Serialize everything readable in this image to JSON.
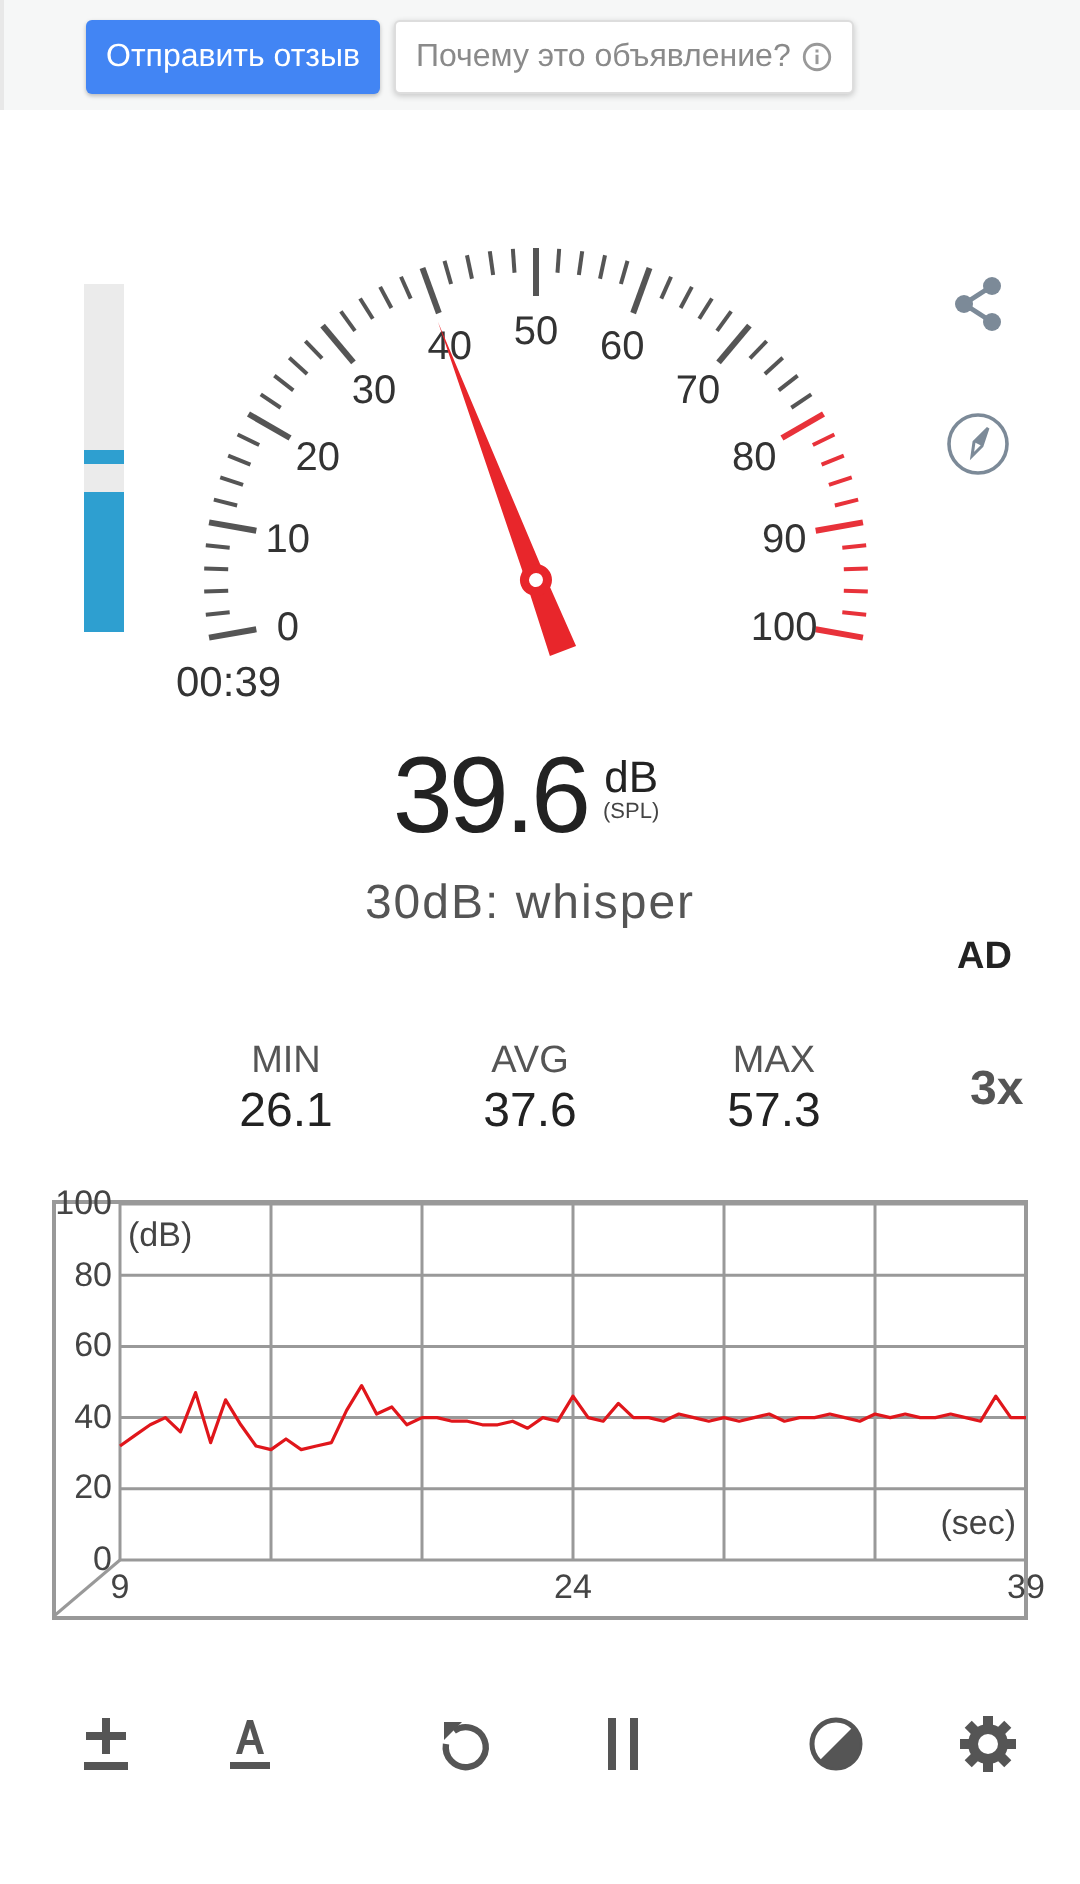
{
  "ad_bar": {
    "buttons": [
      {
        "label": "Отправить отзыв",
        "kind": "primary"
      },
      {
        "label": "Почему это объявление?",
        "kind": "info"
      }
    ]
  },
  "level_meter": {
    "level": 0.4,
    "peak": {
      "level": 0.48
    }
  },
  "gauge": {
    "scale": [
      {
        "label": "50",
        "danger": false
      },
      {
        "label": "40",
        "danger": false
      },
      {
        "label": "60",
        "danger": false
      },
      {
        "label": "30",
        "danger": false
      },
      {
        "label": "70",
        "danger": false
      },
      {
        "label": "20",
        "danger": false
      },
      {
        "label": "80",
        "danger": true
      },
      {
        "label": "10",
        "danger": false
      },
      {
        "label": "90",
        "danger": true
      },
      {
        "label": "0",
        "danger": false
      },
      {
        "label": "100",
        "danger": true
      }
    ]
  },
  "side_actions": [
    {
      "kind": "share"
    },
    {
      "kind": "compass"
    }
  ],
  "elapsed_time": "00:39",
  "reading": {
    "value": "39.6",
    "unit": "dB",
    "qualifier": "(SPL)"
  },
  "reference": "30dB: whisper",
  "ad_label": "AD",
  "stats": [
    {
      "label": "MIN",
      "value": "26.1"
    },
    {
      "label": "AVG",
      "value": "37.6"
    },
    {
      "label": "MAX",
      "value": "57.3"
    }
  ],
  "zoom": "3x",
  "chart": {
    "chart_data": {
      "type": "line",
      "grid": true,
      "xlabel": "(sec)",
      "ylabel": "(dB)",
      "xlim": [
        9,
        39
      ],
      "ylim": [
        0,
        100
      ],
      "xticks": [
        9,
        24,
        39
      ],
      "yticks": [
        0,
        20,
        40,
        60,
        80,
        100
      ],
      "x": [
        9,
        9.5,
        10,
        10.5,
        11,
        11.5,
        12,
        12.5,
        13,
        13.5,
        14,
        14.5,
        15,
        15.5,
        16,
        16.5,
        17,
        17.5,
        18,
        18.5,
        19,
        19.5,
        20,
        20.5,
        21,
        21.5,
        22,
        22.5,
        23,
        23.5,
        24,
        24.5,
        25,
        25.5,
        26,
        26.5,
        27,
        27.5,
        28,
        28.5,
        29,
        29.5,
        30,
        30.5,
        31,
        31.5,
        32,
        32.5,
        33,
        33.5,
        34,
        34.5,
        35,
        35.5,
        36,
        36.5,
        37,
        37.5,
        38,
        38.5,
        39
      ],
      "series": [
        {
          "color": "#e0161b",
          "values": [
            32,
            35,
            38,
            40,
            36,
            47,
            33,
            45,
            38,
            32,
            31,
            34,
            31,
            32,
            33,
            42,
            49,
            41,
            43,
            38,
            40,
            40,
            39,
            39,
            38,
            38,
            39,
            37,
            40,
            39,
            46,
            40,
            39,
            44,
            40,
            40,
            39,
            41,
            40,
            39,
            40,
            39,
            40,
            41,
            39,
            40,
            40,
            41,
            40,
            39,
            41,
            40,
            41,
            40,
            40,
            41,
            40,
            39,
            46,
            40,
            40
          ]
        }
      ]
    }
  },
  "toolbar": [
    {
      "kind": "calibrate"
    },
    {
      "kind": "font"
    },
    {
      "kind": "reset"
    },
    {
      "kind": "pause"
    },
    {
      "kind": "theme"
    },
    {
      "kind": "settings"
    }
  ]
}
